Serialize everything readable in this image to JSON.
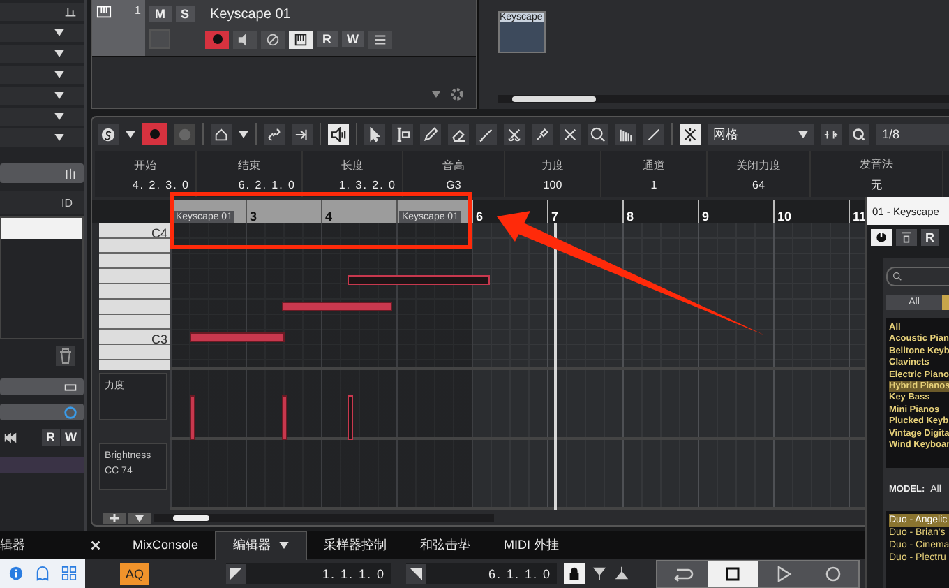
{
  "track": {
    "number": "1",
    "name": "Keyscape 01",
    "mute": "M",
    "solo": "S",
    "read": "R",
    "write": "W",
    "record_armed": true
  },
  "arrange_clip": "Keyscape",
  "inspector": {
    "column_header": "ID",
    "read": "R",
    "write": "W"
  },
  "toolbar": {
    "snap_type": "网格",
    "quantize": "1/8"
  },
  "info": [
    {
      "label": "开始",
      "value": "4. 2. 3. 0"
    },
    {
      "label": "结束",
      "value": "6. 2. 1. 0"
    },
    {
      "label": "长度",
      "value": "1. 3. 2. 0"
    },
    {
      "label": "音高",
      "value": "G3"
    },
    {
      "label": "力度",
      "value": "100"
    },
    {
      "label": "通道",
      "value": "1"
    },
    {
      "label": "关闭力度",
      "value": "64"
    },
    {
      "label": "发音法",
      "value": "无"
    }
  ],
  "ruler": [
    {
      "kind": "part-label",
      "text": "Keyscape 01"
    },
    {
      "kind": "part-bar",
      "text": "3"
    },
    {
      "kind": "part-bar",
      "text": "4"
    },
    {
      "kind": "part-label",
      "text": "Keyscape 01"
    },
    {
      "kind": "bar",
      "text": "6"
    },
    {
      "kind": "bar",
      "text": "7"
    },
    {
      "kind": "bar",
      "text": "8"
    },
    {
      "kind": "bar",
      "text": "9"
    },
    {
      "kind": "bar",
      "text": "10"
    },
    {
      "kind": "bar",
      "text": "11"
    }
  ],
  "piano_labels": [
    "C4",
    "C3"
  ],
  "notes": [
    {
      "selected": false
    },
    {
      "selected": false
    },
    {
      "selected": true
    }
  ],
  "lanes": [
    {
      "name": "力度"
    },
    {
      "name": "Brightness",
      "sub": "CC 74"
    }
  ],
  "zone_tab": "辑器",
  "bottom_tabs": [
    {
      "label": "MixConsole",
      "selected": false,
      "dropdown": false
    },
    {
      "label": "编辑器",
      "selected": true,
      "dropdown": true
    },
    {
      "label": "采样器控制",
      "selected": false,
      "dropdown": false
    },
    {
      "label": "和弦击垫",
      "selected": false,
      "dropdown": false
    },
    {
      "label": "MIDI 外挂",
      "selected": false,
      "dropdown": false
    }
  ],
  "transport": {
    "aq": "AQ",
    "left_locator": "1. 1. 1. 0",
    "right_locator": "6. 1. 1. 0"
  },
  "plugin": {
    "title": "01 - Keyscape",
    "read": "R",
    "filter_tab": "All",
    "categories": [
      {
        "label": "All",
        "selected": false
      },
      {
        "label": "Acoustic Pian",
        "selected": false
      },
      {
        "label": "Belltone Keyb",
        "selected": false
      },
      {
        "label": "Clavinets",
        "selected": false
      },
      {
        "label": "Electric Piano",
        "selected": false
      },
      {
        "label": "Hybrid Pianos",
        "selected": true
      },
      {
        "label": "Key Bass",
        "selected": false
      },
      {
        "label": "Mini Pianos",
        "selected": false
      },
      {
        "label": "Plucked Keyb",
        "selected": false
      },
      {
        "label": "Vintage Digita",
        "selected": false
      },
      {
        "label": "Wind Keyboar",
        "selected": false
      }
    ],
    "model_label": "MODEL:",
    "model_value": "All",
    "presets": [
      {
        "label": "Duo - Angelic",
        "selected": true
      },
      {
        "label": "Duo - Brian's",
        "selected": false
      },
      {
        "label": "Duo - Cinema",
        "selected": false
      },
      {
        "label": "Duo - Plectru",
        "selected": false
      }
    ]
  }
}
